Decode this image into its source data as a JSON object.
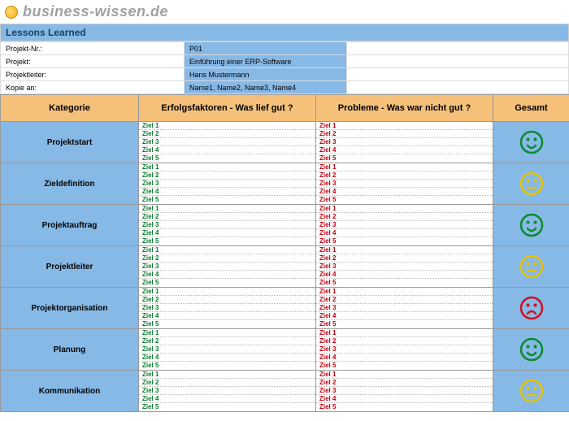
{
  "brand": "business-wissen.de",
  "title": "Lessons Learned",
  "meta": {
    "project_nr_label": "Projekt-Nr.:",
    "project_nr": "P01",
    "project_label": "Projekt:",
    "project": "Einführung einer ERP-Software",
    "leader_label": "Projektleiter:",
    "leader": "Hans Mustermann",
    "copy_label": "Kopie an:",
    "copy": "Name1, Name2, Name3, Name4"
  },
  "columns": {
    "category": "Kategorie",
    "success": "Erfolgsfaktoren - Was lief gut ?",
    "problems": "Probleme - Was war nicht gut ?",
    "total": "Gesamt"
  },
  "goals": [
    "Ziel 1",
    "Ziel 2",
    "Ziel 3",
    "Ziel 4",
    "Ziel 5"
  ],
  "rows": [
    {
      "category": "Projektstart",
      "mood": "happy",
      "color": "#0a8a2e"
    },
    {
      "category": "Zieldefinition",
      "mood": "neutral",
      "color": "#e6c200"
    },
    {
      "category": "Projektauftrag",
      "mood": "happy",
      "color": "#0a8a2e"
    },
    {
      "category": "Projektleiter",
      "mood": "neutral",
      "color": "#e6c200"
    },
    {
      "category": "Projektorganisation",
      "mood": "sad",
      "color": "#d01020"
    },
    {
      "category": "Planung",
      "mood": "happy",
      "color": "#0a8a2e"
    },
    {
      "category": "Kommunikation",
      "mood": "neutral",
      "color": "#e6c200"
    }
  ]
}
